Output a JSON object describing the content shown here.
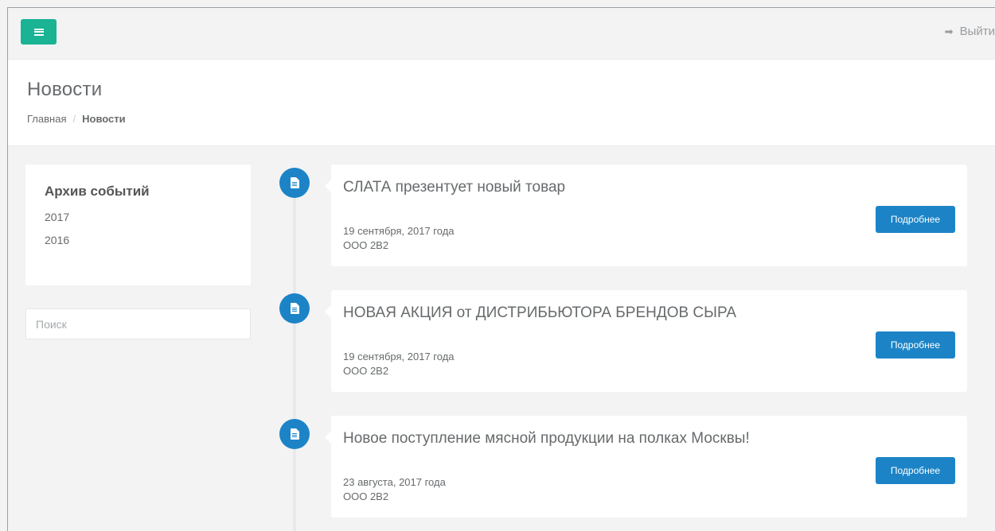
{
  "topbar": {
    "menu_icon": "bars-icon",
    "logout_icon": "sign-out-icon",
    "logout_label": "Выйти"
  },
  "heading": {
    "title": "Новости",
    "breadcrumb": [
      "Главная",
      "Новости"
    ]
  },
  "sidebar": {
    "archive_title": "Архив событий",
    "years": [
      "2017",
      "2016"
    ],
    "search_placeholder": "Поиск"
  },
  "news": [
    {
      "title": "СЛАТА презентует новый товар",
      "date": "19 сентября, 2017 года",
      "org": "ООО 2В2",
      "button": "Подробнее",
      "icon": "file-text-icon"
    },
    {
      "title": "НОВАЯ АКЦИЯ от ДИСТРИБЬЮТОРА БРЕНДОВ СЫРА",
      "date": "19 сентября, 2017 года",
      "org": "ООО 2В2",
      "button": "Подробнее",
      "icon": "file-text-icon"
    },
    {
      "title": "Новое поступление мясной продукции на полках Москвы!",
      "date": "23 августа, 2017 года",
      "org": "ООО 2В2",
      "button": "Подробнее",
      "icon": "file-text-icon"
    }
  ],
  "colors": {
    "accent_green": "#1ab394",
    "accent_blue": "#1c84c6",
    "background": "#f3f3f4"
  }
}
